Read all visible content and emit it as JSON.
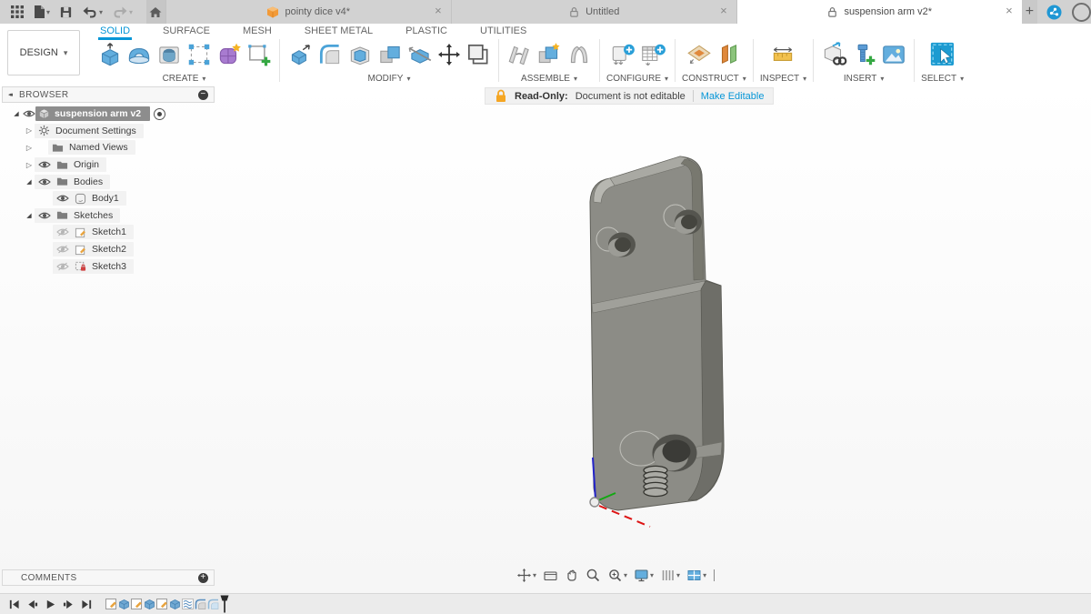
{
  "app": {
    "tabs": [
      {
        "title": "pointy dice v4*",
        "icon": "model-cube",
        "state": "inactive"
      },
      {
        "title": "Untitled",
        "icon": "lock",
        "state": "inactive"
      },
      {
        "title": "suspension arm v2*",
        "icon": "lock",
        "state": "active"
      }
    ]
  },
  "toolbar": {
    "design_menu": "DESIGN",
    "ribbon_tabs": [
      {
        "label": "SOLID",
        "active": true
      },
      {
        "label": "SURFACE",
        "active": false
      },
      {
        "label": "MESH",
        "active": false
      },
      {
        "label": "SHEET METAL",
        "active": false
      },
      {
        "label": "PLASTIC",
        "active": false
      },
      {
        "label": "UTILITIES",
        "active": false
      }
    ],
    "groups": [
      {
        "label": "CREATE",
        "icons": [
          "extrude",
          "revolve",
          "hole",
          "rectangular-pattern",
          "form",
          "create-sketch"
        ]
      },
      {
        "label": "MODIFY",
        "icons": [
          "press-pull",
          "fillet",
          "shell",
          "combine",
          "split-body",
          "move-copy",
          "align"
        ]
      },
      {
        "label": "ASSEMBLE",
        "icons": [
          "joint",
          "new-component",
          "as-built-joint"
        ]
      },
      {
        "label": "CONFIGURE",
        "icons": [
          "configuration",
          "configuration-table"
        ]
      },
      {
        "label": "CONSTRUCT",
        "icons": [
          "construction-plane",
          "offset-plane"
        ]
      },
      {
        "label": "INSPECT",
        "icons": [
          "measure"
        ]
      },
      {
        "label": "INSERT",
        "icons": [
          "derive",
          "insert-fastener",
          "insert-image"
        ]
      },
      {
        "label": "SELECT",
        "icons": [
          "select"
        ]
      }
    ]
  },
  "readonly_banner": {
    "label": "Read-Only:",
    "message": "Document is not editable",
    "action": "Make Editable"
  },
  "browser_panel": {
    "title": "BROWSER",
    "items": [
      {
        "label": "suspension arm v2",
        "icon": "component",
        "eye": "on",
        "expand": "open",
        "selected": true,
        "radio": true
      },
      {
        "label": "Document Settings",
        "icon": "gear",
        "eye": "none",
        "expand": "closed"
      },
      {
        "label": "Named Views",
        "icon": "folder",
        "eye": "none",
        "expand": "closed"
      },
      {
        "label": "Origin",
        "icon": "folder",
        "eye": "on",
        "expand": "closed"
      },
      {
        "label": "Bodies",
        "icon": "folder",
        "eye": "on",
        "expand": "open"
      },
      {
        "label": "Body1",
        "icon": "body",
        "eye": "on",
        "expand": "none"
      },
      {
        "label": "Sketches",
        "icon": "folder",
        "eye": "on",
        "expand": "open"
      },
      {
        "label": "Sketch1",
        "icon": "sketch",
        "eye": "off",
        "expand": "none"
      },
      {
        "label": "Sketch2",
        "icon": "sketch",
        "eye": "off",
        "expand": "none"
      },
      {
        "label": "Sketch3",
        "icon": "sketch-locked",
        "eye": "off",
        "expand": "none"
      }
    ]
  },
  "comments_panel": {
    "title": "COMMENTS"
  },
  "timeline": {
    "controls": [
      "go-to-start",
      "step-back",
      "play",
      "step-forward",
      "go-to-end"
    ],
    "features": [
      "sketch",
      "extrude",
      "sketch",
      "extrude",
      "sketch",
      "extrude",
      "coil",
      "fillet",
      "fillet"
    ]
  },
  "navbar": {
    "tools": [
      "orbit",
      "look-at",
      "pan",
      "zoom",
      "fit",
      "display-settings",
      "grid-and-snaps",
      "viewports"
    ]
  },
  "icons": {
    "caret_down": "▾",
    "close": "×",
    "new_tab": "+",
    "collapse_double": "◂◂",
    "expand_open": "◢",
    "expand_closed": "▷",
    "panel_minus": "−",
    "panel_plus": "+"
  },
  "colors": {
    "accent_blue": "#0696d7",
    "readonly_lock_orange": "#f5a623",
    "selected_row_gray": "#8d8d8d",
    "topbar_gray": "#d2d2d2",
    "model_gray": "#8c8c86"
  }
}
